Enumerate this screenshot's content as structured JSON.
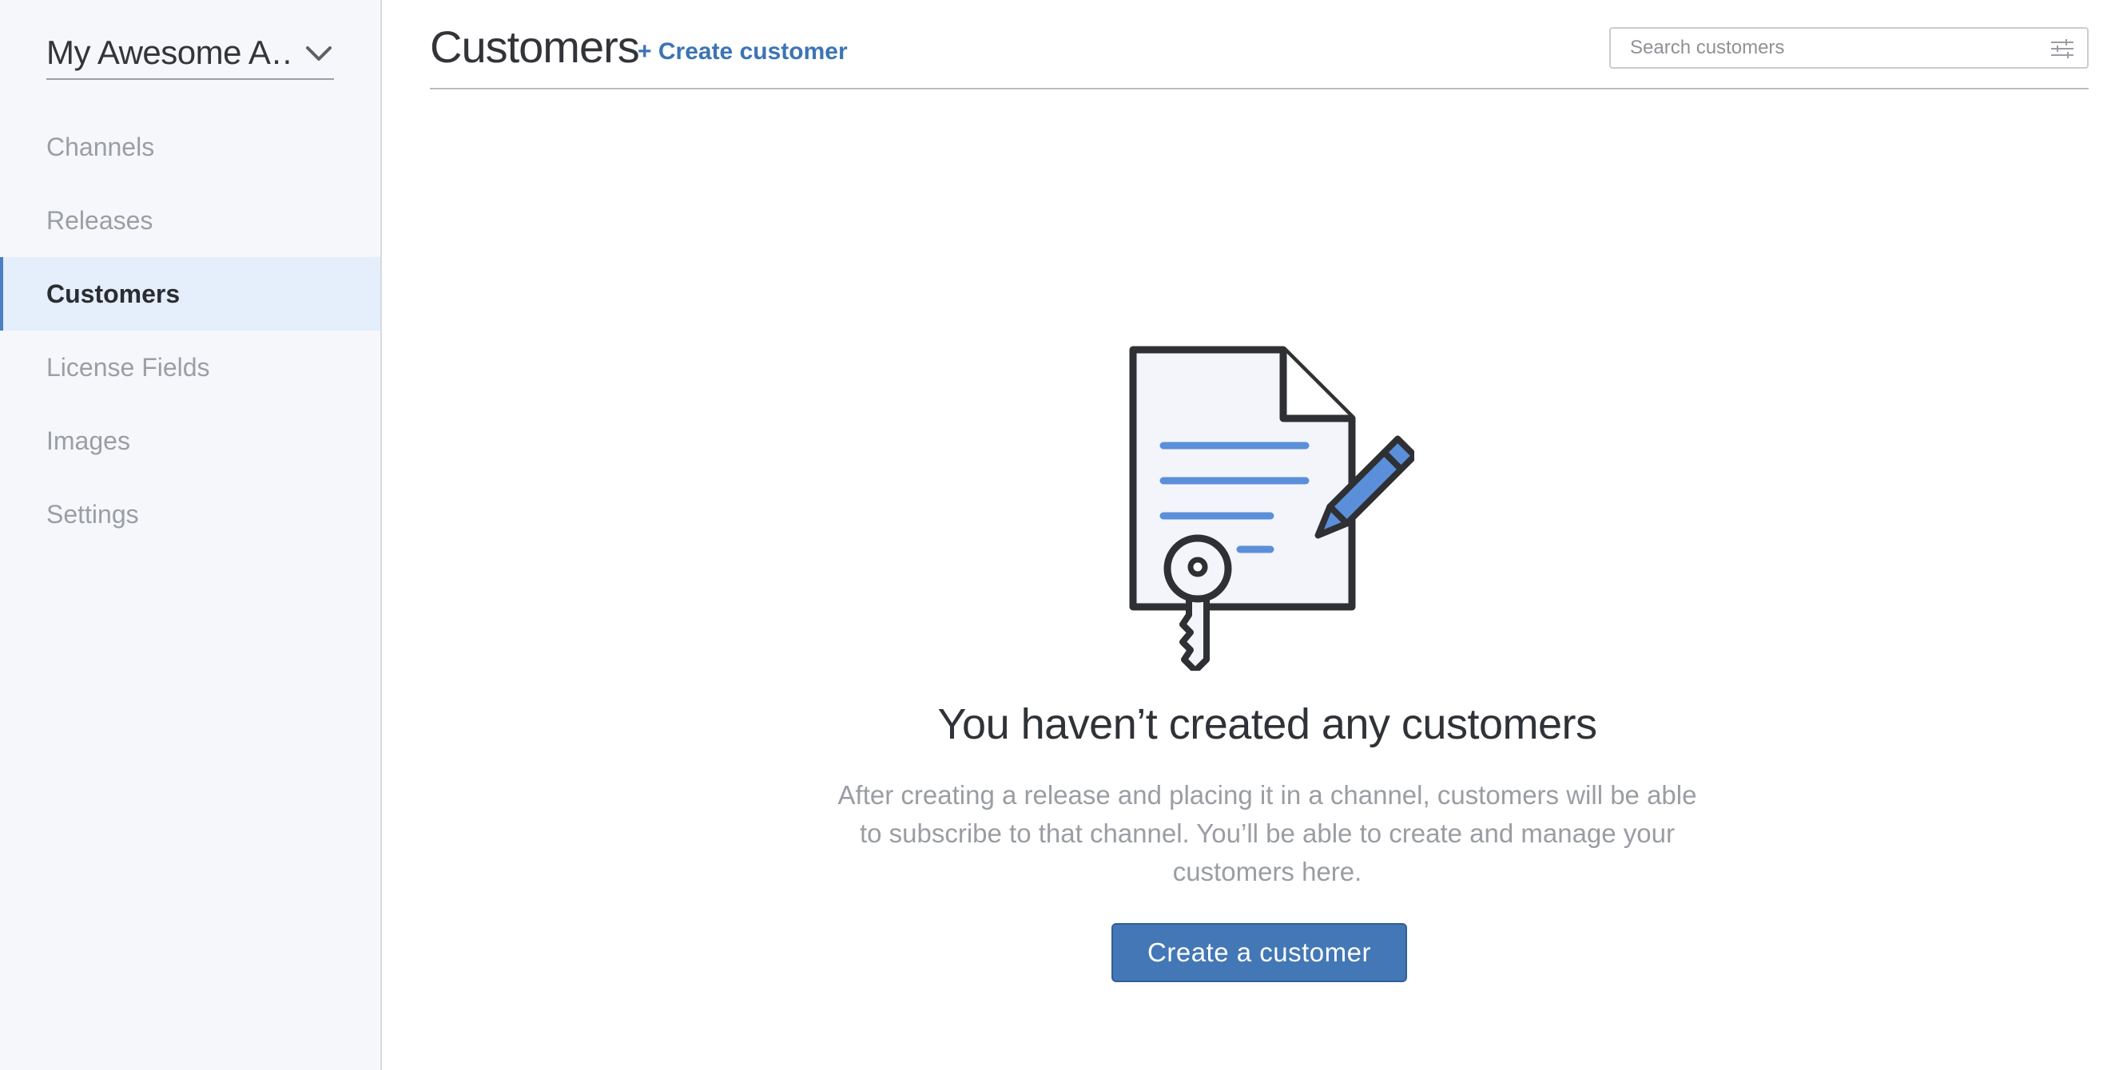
{
  "sidebar": {
    "app_name": "My Awesome A…",
    "items": [
      {
        "label": "Channels",
        "active": false
      },
      {
        "label": "Releases",
        "active": false
      },
      {
        "label": "Customers",
        "active": true
      },
      {
        "label": "License Fields",
        "active": false
      },
      {
        "label": "Images",
        "active": false
      },
      {
        "label": "Settings",
        "active": false
      }
    ]
  },
  "header": {
    "title": "Customers",
    "create_link": "+ Create customer",
    "search_placeholder": "Search customers"
  },
  "empty_state": {
    "title": "You haven’t created any customers",
    "description": "After creating a release and placing it in a channel, customers will be able to subscribe to that channel. You’ll be able to create and manage your customers here.",
    "button_label": "Create a customer"
  },
  "colors": {
    "accent": "#4377b5",
    "link": "#3c74b5",
    "sidebar_bg": "#f5f7fb",
    "active_item_bg": "#e5eefb",
    "illustration_blue": "#5b8fd9"
  },
  "icons": [
    "chevron-down-icon",
    "filter-icon",
    "license-document-icon",
    "pencil-icon",
    "key-icon"
  ]
}
